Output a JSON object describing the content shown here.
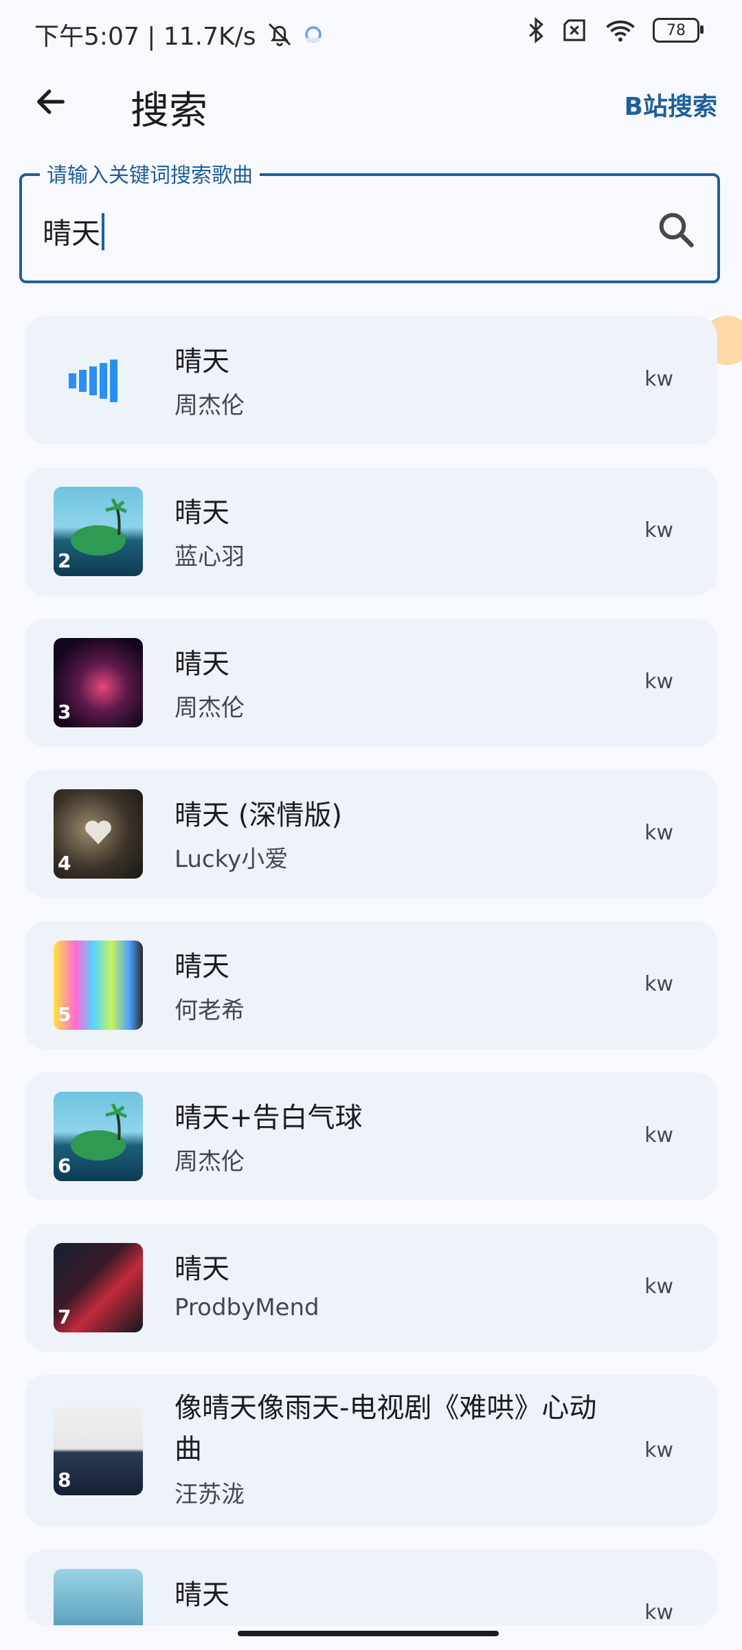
{
  "status_bar": {
    "time_net": "下午5:07 | 11.7K/s",
    "battery": "78"
  },
  "app_bar": {
    "title": "搜索",
    "bili_search_label": "B站搜索"
  },
  "search": {
    "label": "请输入关键词搜索歌曲",
    "value": "晴天"
  },
  "results": [
    {
      "title": "晴天",
      "artist": "周杰伦",
      "source": "kw",
      "index": "",
      "thumb": "playing-bars"
    },
    {
      "title": "晴天",
      "artist": "蓝心羽",
      "source": "kw",
      "index": "2",
      "thumb": "island"
    },
    {
      "title": "晴天",
      "artist": "周杰伦",
      "source": "kw",
      "index": "3",
      "thumb": "concert"
    },
    {
      "title": "晴天 (深情版)",
      "artist": "Lucky小爱",
      "source": "kw",
      "index": "4",
      "thumb": "heart-stone"
    },
    {
      "title": "晴天",
      "artist": "何老希",
      "source": "kw",
      "index": "5",
      "thumb": "glitch"
    },
    {
      "title": "晴天+告白气球",
      "artist": "周杰伦",
      "source": "kw",
      "index": "6",
      "thumb": "island"
    },
    {
      "title": "晴天",
      "artist": "ProdbyMend",
      "source": "kw",
      "index": "7",
      "thumb": "city"
    },
    {
      "title": "像晴天像雨天-电视剧《难哄》心动曲",
      "artist": "汪苏泷",
      "source": "kw",
      "index": "8",
      "thumb": "paper"
    },
    {
      "title": "晴天",
      "artist": "",
      "source": "kw",
      "index": "",
      "thumb": "girl"
    }
  ],
  "colors": {
    "accent": "#1e5f9a",
    "card_bg": "#eef2f9",
    "page_bg": "#f8f9fe",
    "playing_bars": "#2a8ff0"
  }
}
